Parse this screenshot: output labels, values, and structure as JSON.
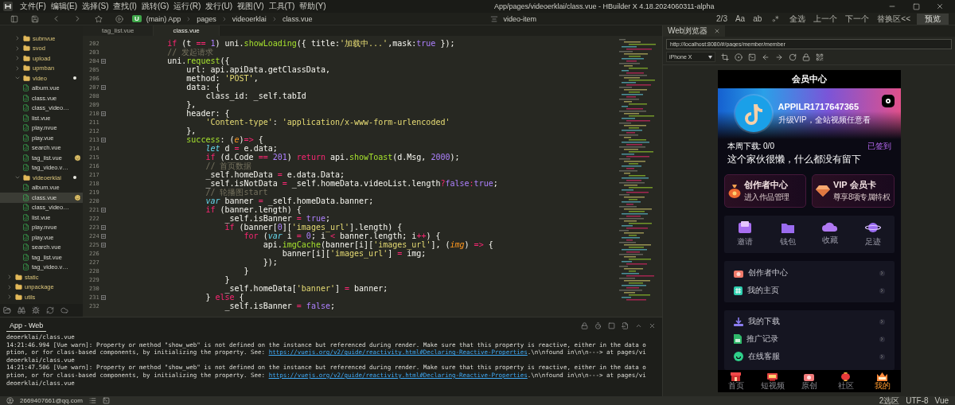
{
  "window": {
    "menu": [
      "文件(F)",
      "编辑(E)",
      "选择(S)",
      "查找(I)",
      "跳转(G)",
      "运行(R)",
      "发行(U)",
      "视图(V)",
      "工具(T)",
      "帮助(Y)"
    ],
    "title": "App/pages/videoerklai/class.vue - HBuilder X 4.18.2024060311-alpha"
  },
  "toolbar": {
    "project_badge": "U",
    "breadcrumb": [
      "(main) App",
      "pages",
      "videoerklai",
      "class.vue"
    ],
    "symbol": "video-item",
    "find_count": "2/3",
    "find_toggles": [
      "Aa",
      "ab"
    ],
    "find_actions": [
      "全选",
      "上一个",
      "下一个",
      "替换区<<"
    ],
    "preview": "预览"
  },
  "tree": [
    {
      "kind": "offscreen",
      "children": [
        {
          "kind": "folder",
          "name": "subnvue",
          "expanded": false,
          "modified": false,
          "selected": false
        },
        {
          "kind": "folder",
          "name": "svod",
          "expanded": false,
          "modified": false,
          "selected": false
        },
        {
          "kind": "folder",
          "name": "upload",
          "expanded": false,
          "modified": false,
          "selected": false
        },
        {
          "kind": "folder",
          "name": "upmban",
          "expanded": false,
          "modified": false,
          "selected": false
        },
        {
          "kind": "folder",
          "name": "video",
          "expanded": true,
          "modified": true,
          "selected": false,
          "children": [
            {
              "kind": "file",
              "name": "album.vue",
              "flagged": false,
              "selected": false
            },
            {
              "kind": "file",
              "name": "class.vue",
              "flagged": false,
              "selected": false
            },
            {
              "kind": "file",
              "name": "class_video…",
              "flagged": false,
              "selected": false
            },
            {
              "kind": "file",
              "name": "list.vue",
              "flagged": false,
              "selected": false
            },
            {
              "kind": "file",
              "name": "play.nvue",
              "flagged": false,
              "selected": false
            },
            {
              "kind": "file",
              "name": "play.vue",
              "flagged": false,
              "selected": false
            },
            {
              "kind": "file",
              "name": "search.vue",
              "flagged": false,
              "selected": false
            },
            {
              "kind": "file",
              "name": "tag_list.vue",
              "flagged": true,
              "selected": false
            },
            {
              "kind": "file",
              "name": "tag_video.v…",
              "flagged": false,
              "selected": false
            }
          ]
        },
        {
          "kind": "folder",
          "name": "videoerklai",
          "expanded": true,
          "modified": true,
          "selected": false,
          "children": [
            {
              "kind": "file",
              "name": "album.vue",
              "flagged": false,
              "selected": false
            },
            {
              "kind": "file",
              "name": "class.vue",
              "flagged": true,
              "selected": true
            },
            {
              "kind": "file",
              "name": "class_video…",
              "flagged": false,
              "selected": false
            },
            {
              "kind": "file",
              "name": "list.vue",
              "flagged": false,
              "selected": false
            },
            {
              "kind": "file",
              "name": "play.nvue",
              "flagged": false,
              "selected": false
            },
            {
              "kind": "file",
              "name": "play.vue",
              "flagged": false,
              "selected": false
            },
            {
              "kind": "file",
              "name": "search.vue",
              "flagged": false,
              "selected": false
            },
            {
              "kind": "file",
              "name": "tag_list.vue",
              "flagged": false,
              "selected": false
            },
            {
              "kind": "file",
              "name": "tag_video.v…",
              "flagged": false,
              "selected": false
            }
          ]
        }
      ]
    },
    {
      "kind": "folder",
      "name": "static",
      "expanded": false,
      "modified": false,
      "selected": false
    },
    {
      "kind": "folder",
      "name": "unpackage",
      "expanded": false,
      "modified": false,
      "selected": false
    },
    {
      "kind": "folder",
      "name": "utils",
      "expanded": false,
      "modified": false,
      "selected": false
    }
  ],
  "editor_tabs": [
    {
      "label": "tag_list.vue",
      "selected": false
    },
    {
      "label": "class.vue",
      "selected": true
    }
  ],
  "code": [
    {
      "number": "202",
      "fold": false,
      "tokens": [
        {
          "kind": "keyword",
          "text": "            if"
        },
        {
          "kind": "plain",
          "text": " (t "
        },
        {
          "kind": "operator",
          "text": "=="
        },
        {
          "kind": "number",
          "text": " 1"
        },
        {
          "kind": "plain",
          "text": ") uni."
        },
        {
          "kind": "function",
          "text": "showLoading"
        },
        {
          "kind": "plain",
          "text": "({ title:"
        },
        {
          "kind": "string",
          "text": "'加载中...'"
        },
        {
          "kind": "plain",
          "text": ",mask:"
        },
        {
          "kind": "number",
          "text": "true"
        },
        {
          "kind": "plain",
          "text": " });"
        }
      ]
    },
    {
      "number": "203",
      "fold": false,
      "tokens": [
        {
          "kind": "comment",
          "text": "            // 发起请求"
        }
      ]
    },
    {
      "number": "204",
      "fold": true,
      "tokens": [
        {
          "kind": "plain",
          "text": "            uni."
        },
        {
          "kind": "function",
          "text": "request"
        },
        {
          "kind": "plain",
          "text": "({"
        }
      ]
    },
    {
      "number": "205",
      "fold": false,
      "tokens": [
        {
          "kind": "plain",
          "text": "                url: api.apiData.getClassData,"
        }
      ]
    },
    {
      "number": "206",
      "fold": false,
      "tokens": [
        {
          "kind": "plain",
          "text": "                method: "
        },
        {
          "kind": "string",
          "text": "'POST'"
        },
        {
          "kind": "plain",
          "text": ","
        }
      ]
    },
    {
      "number": "207",
      "fold": true,
      "tokens": [
        {
          "kind": "plain",
          "text": "                data: {"
        }
      ]
    },
    {
      "number": "208",
      "fold": false,
      "tokens": [
        {
          "kind": "plain",
          "text": "                    class_id: _self.tabId"
        }
      ]
    },
    {
      "number": "209",
      "fold": false,
      "tokens": [
        {
          "kind": "plain",
          "text": "                },"
        }
      ]
    },
    {
      "number": "210",
      "fold": true,
      "tokens": [
        {
          "kind": "plain",
          "text": "                header: {"
        }
      ]
    },
    {
      "number": "211",
      "fold": false,
      "tokens": [
        {
          "kind": "string",
          "text": "                    'Content-type'"
        },
        {
          "kind": "plain",
          "text": ": "
        },
        {
          "kind": "string",
          "text": "'application/x-www-form-urlencoded'"
        }
      ]
    },
    {
      "number": "212",
      "fold": false,
      "tokens": [
        {
          "kind": "plain",
          "text": "                },"
        }
      ]
    },
    {
      "number": "213",
      "fold": true,
      "tokens": [
        {
          "kind": "function",
          "text": "                success"
        },
        {
          "kind": "plain",
          "text": ": ("
        },
        {
          "kind": "param",
          "text": "e"
        },
        {
          "kind": "plain",
          "text": ")"
        },
        {
          "kind": "operator",
          "text": "=>"
        },
        {
          "kind": "plain",
          "text": " {"
        }
      ]
    },
    {
      "number": "214",
      "fold": false,
      "tokens": [
        {
          "kind": "storage",
          "text": "                    let"
        },
        {
          "kind": "plain",
          "text": " d "
        },
        {
          "kind": "operator",
          "text": "="
        },
        {
          "kind": "plain",
          "text": " e.data;"
        }
      ]
    },
    {
      "number": "215",
      "fold": false,
      "tokens": [
        {
          "kind": "keyword",
          "text": "                    if"
        },
        {
          "kind": "plain",
          "text": " (d.Code "
        },
        {
          "kind": "operator",
          "text": "=="
        },
        {
          "kind": "number",
          "text": " 201"
        },
        {
          "kind": "plain",
          "text": ") "
        },
        {
          "kind": "keyword",
          "text": "return"
        },
        {
          "kind": "plain",
          "text": " api."
        },
        {
          "kind": "function",
          "text": "showToast"
        },
        {
          "kind": "plain",
          "text": "(d.Msg, "
        },
        {
          "kind": "number",
          "text": "2000"
        },
        {
          "kind": "plain",
          "text": ");"
        }
      ]
    },
    {
      "number": "216",
      "fold": false,
      "tokens": [
        {
          "kind": "comment",
          "text": "                    // 首页数据"
        }
      ]
    },
    {
      "number": "217",
      "fold": false,
      "tokens": [
        {
          "kind": "plain",
          "text": "                    _self.homeData "
        },
        {
          "kind": "operator",
          "text": "="
        },
        {
          "kind": "plain",
          "text": " e.data.Data;"
        }
      ]
    },
    {
      "number": "218",
      "fold": false,
      "tokens": [
        {
          "kind": "plain",
          "text": "                    _self.isNotData "
        },
        {
          "kind": "operator",
          "text": "="
        },
        {
          "kind": "plain",
          "text": " _self.homeData.videoList.length"
        },
        {
          "kind": "operator",
          "text": "?"
        },
        {
          "kind": "number",
          "text": "false"
        },
        {
          "kind": "operator",
          "text": ":"
        },
        {
          "kind": "number",
          "text": "true"
        },
        {
          "kind": "plain",
          "text": ";"
        }
      ]
    },
    {
      "number": "219",
      "fold": false,
      "tokens": [
        {
          "kind": "comment",
          "text": "                    // 轮播图start"
        }
      ]
    },
    {
      "number": "220",
      "fold": false,
      "tokens": [
        {
          "kind": "storage",
          "text": "                    var"
        },
        {
          "kind": "plain",
          "text": " banner "
        },
        {
          "kind": "operator",
          "text": "="
        },
        {
          "kind": "plain",
          "text": " _self.homeData.banner;"
        }
      ]
    },
    {
      "number": "221",
      "fold": true,
      "tokens": [
        {
          "kind": "keyword",
          "text": "                    if"
        },
        {
          "kind": "plain",
          "text": " (banner.length) {"
        }
      ]
    },
    {
      "number": "222",
      "fold": false,
      "tokens": [
        {
          "kind": "plain",
          "text": "                        _self.isBanner "
        },
        {
          "kind": "operator",
          "text": "="
        },
        {
          "kind": "number",
          "text": " true"
        },
        {
          "kind": "plain",
          "text": ";"
        }
      ]
    },
    {
      "number": "223",
      "fold": true,
      "tokens": [
        {
          "kind": "keyword",
          "text": "                        if"
        },
        {
          "kind": "plain",
          "text": " (banner["
        },
        {
          "kind": "number",
          "text": "0"
        },
        {
          "kind": "plain",
          "text": "]["
        },
        {
          "kind": "string",
          "text": "'images_url'"
        },
        {
          "kind": "plain",
          "text": "].length) {"
        }
      ]
    },
    {
      "number": "224",
      "fold": true,
      "tokens": [
        {
          "kind": "keyword",
          "text": "                            for"
        },
        {
          "kind": "plain",
          "text": " ("
        },
        {
          "kind": "storage",
          "text": "var"
        },
        {
          "kind": "plain",
          "text": " i "
        },
        {
          "kind": "operator",
          "text": "="
        },
        {
          "kind": "number",
          "text": " 0"
        },
        {
          "kind": "plain",
          "text": "; i "
        },
        {
          "kind": "operator",
          "text": "<"
        },
        {
          "kind": "plain",
          "text": " banner.length; i"
        },
        {
          "kind": "operator",
          "text": "++"
        },
        {
          "kind": "plain",
          "text": ") {"
        }
      ]
    },
    {
      "number": "225",
      "fold": true,
      "tokens": [
        {
          "kind": "plain",
          "text": "                                api."
        },
        {
          "kind": "function",
          "text": "imgCache"
        },
        {
          "kind": "plain",
          "text": "(banner[i]["
        },
        {
          "kind": "string",
          "text": "'images_url'"
        },
        {
          "kind": "plain",
          "text": "], ("
        },
        {
          "kind": "param",
          "text": "img"
        },
        {
          "kind": "plain",
          "text": ") "
        },
        {
          "kind": "operator",
          "text": "=>"
        },
        {
          "kind": "plain",
          "text": " {"
        }
      ]
    },
    {
      "number": "226",
      "fold": false,
      "tokens": [
        {
          "kind": "plain",
          "text": "                                    banner[i]["
        },
        {
          "kind": "string",
          "text": "'images_url'"
        },
        {
          "kind": "plain",
          "text": "] "
        },
        {
          "kind": "operator",
          "text": "="
        },
        {
          "kind": "plain",
          "text": " img;"
        }
      ]
    },
    {
      "number": "227",
      "fold": false,
      "tokens": [
        {
          "kind": "plain",
          "text": "                                });"
        }
      ]
    },
    {
      "number": "228",
      "fold": false,
      "tokens": [
        {
          "kind": "plain",
          "text": "                            }"
        }
      ]
    },
    {
      "number": "229",
      "fold": false,
      "tokens": [
        {
          "kind": "plain",
          "text": "                        }"
        }
      ]
    },
    {
      "number": "230",
      "fold": false,
      "tokens": [
        {
          "kind": "plain",
          "text": "                        _self.homeData["
        },
        {
          "kind": "string",
          "text": "'banner'"
        },
        {
          "kind": "plain",
          "text": "] "
        },
        {
          "kind": "operator",
          "text": "="
        },
        {
          "kind": "plain",
          "text": " banner;"
        }
      ]
    },
    {
      "number": "231",
      "fold": true,
      "tokens": [
        {
          "kind": "plain",
          "text": "                    } "
        },
        {
          "kind": "keyword",
          "text": "else"
        },
        {
          "kind": "plain",
          "text": " {"
        }
      ]
    },
    {
      "number": "232",
      "fold": false,
      "tokens": [
        {
          "kind": "plain",
          "text": "                        _self.isBanner "
        },
        {
          "kind": "operator",
          "text": "="
        },
        {
          "kind": "number",
          "text": " false"
        },
        {
          "kind": "plain",
          "text": ";"
        }
      ]
    }
  ],
  "console": {
    "tabs": [
      {
        "label": "App - Web",
        "selected": true
      }
    ],
    "lines": [
      {
        "text": "deoerklai/class.vue"
      },
      {
        "text": "14:21:46.994 [Vue warn]: Property or method \"show_web\" is not defined on the instance but referenced during render. Make sure that this property is reactive, either in the data o"
      },
      {
        "text": "ption, or for class-based components, by initializing the property. See: ",
        "link": "https://vuejs.org/v2/guide/reactivity.html#Declaring-Reactive-Properties",
        "rest": ".\\n\\nfound in\\n\\n---> at pages/vi"
      },
      {
        "text": "deoerklai/class.vue"
      },
      {
        "text": "14:21:47.506 [Vue warn]: Property or method \"show_web\" is not defined on the instance but referenced during render. Make sure that this property is reactive, either in the data o"
      },
      {
        "text": "ption, or for class-based components, by initializing the property. See: ",
        "link": "https://vuejs.org/v2/guide/reactivity.html#Declaring-Reactive-Properties",
        "rest": ".\\n\\nfound in\\n\\n---> at pages/vi"
      },
      {
        "text": "deoerklai/class.vue"
      }
    ]
  },
  "browser": {
    "tab": "Web浏览器",
    "url": "http://localhost:8080/#/pages/member/member",
    "device": "iPhone X",
    "phone": {
      "header": "会员中心",
      "username": "APPILR1717647365",
      "tagline": "升级VIP，全站视频任意看",
      "weekly_downloads": "本周下载: 0/0",
      "signin": "已签到",
      "bio": "这个家伙很懒，什么都没有留下",
      "cards": [
        {
          "kind": "creator",
          "title": "创作者中心",
          "subtitle": "进入作品管理"
        },
        {
          "kind": "vip",
          "title": "VIP 会员卡",
          "subtitle": "尊享8项专属特权"
        }
      ],
      "shortcuts": [
        {
          "kind": "inbox",
          "label": "邀请"
        },
        {
          "kind": "wallet",
          "label": "钱包"
        },
        {
          "kind": "cloud",
          "label": "收藏"
        },
        {
          "kind": "planet",
          "label": "足迹"
        }
      ],
      "menu_groups": [
        {
          "items": [
            {
              "kind": "camera",
              "label": "创作者中心"
            },
            {
              "kind": "home",
              "label": "我的主页"
            }
          ]
        },
        {
          "items": [
            {
              "kind": "download",
              "label": "我的下载"
            },
            {
              "kind": "sheet",
              "label": "推广记录"
            },
            {
              "kind": "chat",
              "label": "在线客服"
            }
          ]
        }
      ],
      "nav": [
        {
          "kind": "store",
          "label": "首页",
          "selected": false
        },
        {
          "kind": "tv",
          "label": "短视频",
          "selected": false
        },
        {
          "kind": "camera",
          "label": "原创",
          "selected": false
        },
        {
          "kind": "lantern",
          "label": "社区",
          "selected": false
        },
        {
          "kind": "crown",
          "label": "我的",
          "selected": true
        }
      ]
    }
  },
  "status_bar": {
    "account": "2669407661@qq.com",
    "selection": "2选区",
    "encoding": "UTF-8",
    "language": "Vue"
  }
}
